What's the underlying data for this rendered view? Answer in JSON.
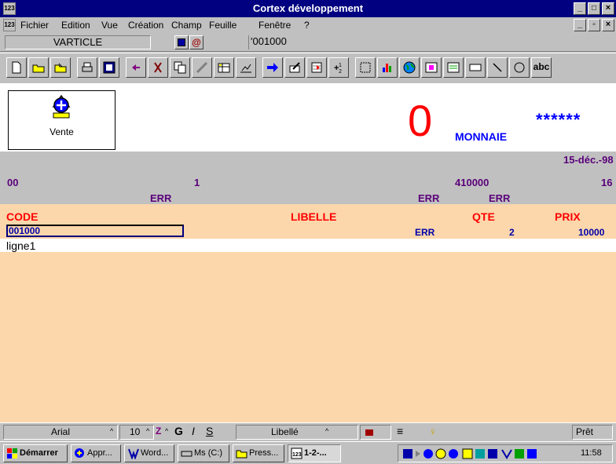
{
  "window": {
    "title": "Cortex développement",
    "minimize": "_",
    "maximize": "□",
    "close": "×"
  },
  "menu": {
    "items": [
      {
        "label": "Fichier"
      },
      {
        "label": "Edition"
      },
      {
        "label": "Vue"
      },
      {
        "label": "Création"
      },
      {
        "label": "Champ"
      },
      {
        "label": "Feuille"
      },
      {
        "label": "Fenêtre"
      },
      {
        "label": "?"
      }
    ]
  },
  "editline": {
    "name_box": "VARTICLE",
    "cell_value": "'001000"
  },
  "vente": {
    "label": "Vente",
    "icon": "cortex-app-icon"
  },
  "display": {
    "amount": "0",
    "currency": "MONNAIE",
    "stars": "******",
    "date": "15-déc.-98"
  },
  "band": {
    "left_code": "00",
    "count": "1",
    "ref": "410000",
    "right_num": "16",
    "err1": "ERR",
    "err2": "ERR",
    "err3": "ERR"
  },
  "table": {
    "headers": {
      "code": "CODE",
      "libelle": "LIBELLE",
      "qte": "QTE",
      "prix": "PRIX"
    },
    "row": {
      "code": "001000",
      "err": "ERR",
      "qte": "2",
      "prix": "10000"
    },
    "line_label": "ligne1"
  },
  "statusbar": {
    "font": "Arial",
    "size": "10",
    "bold": "G",
    "italic": "I",
    "underline": "S",
    "style": "Libellé",
    "status": "Prêt"
  },
  "taskbar": {
    "start": "Démarrer",
    "tasks": [
      {
        "label": "Appr..."
      },
      {
        "label": "Word..."
      },
      {
        "label": "Ms (C:)"
      },
      {
        "label": "Press..."
      },
      {
        "label": "1-2-..."
      }
    ],
    "clock": "11:58"
  },
  "colors": {
    "titlebar": "#000080",
    "client": "#fbd7ab",
    "error": "#ff0000",
    "accent": "#0000ff",
    "band_text": "#5a007a"
  }
}
